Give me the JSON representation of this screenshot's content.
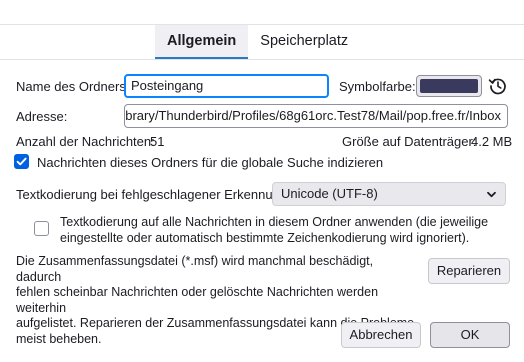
{
  "tabs": [
    {
      "label": "Allgemein",
      "active": true
    },
    {
      "label": "Speicherplatz",
      "active": false
    }
  ],
  "folder_name": {
    "label": "Name des Ordners:",
    "value": "Posteingang"
  },
  "icon_color": {
    "label": "Symbolfarbe:",
    "color": "#3a3a5e",
    "reset_icon": "restore-default-icon"
  },
  "address": {
    "label": "Adresse:",
    "value": "ard/Library/Thunderbird/Profiles/68g61orc.Test78/Mail/pop.free.fr/Inbox"
  },
  "message_count": {
    "label": "Anzahl der Nachrichten:",
    "value": "51"
  },
  "disk_size": {
    "label": "Größe auf Datenträger:",
    "value": "4.2 MB"
  },
  "global_search": {
    "label": "Nachrichten dieses Ordners für die globale Suche indizieren",
    "checked": true
  },
  "fallback_encoding": {
    "label": "Textkodierung bei fehlgeschlagener Erkennung:",
    "selected": "Unicode (UTF-8)"
  },
  "apply_encoding": {
    "line1": "Textkodierung auf alle Nachrichten in diesem Ordner anwenden (die jeweilige",
    "line2": "eingestellte oder automatisch bestimmte Zeichenkodierung wird ignoriert).",
    "checked": false
  },
  "repair": {
    "line1": "Die Zusammenfassungsdatei (*.msf) wird manchmal beschädigt, dadurch",
    "line2": "fehlen scheinbar Nachrichten oder gelöschte Nachrichten werden weiterhin",
    "line3": "aufgelistet. Reparieren der Zusammenfassungsdatei kann die Probleme",
    "line4": "meist beheben.",
    "button": "Reparieren"
  },
  "dialog": {
    "cancel": "Abbrechen",
    "ok": "OK"
  },
  "colors": {
    "accent": "#0060df",
    "focus": "#0a84ff",
    "tab_underline": "#2b7bc0"
  }
}
